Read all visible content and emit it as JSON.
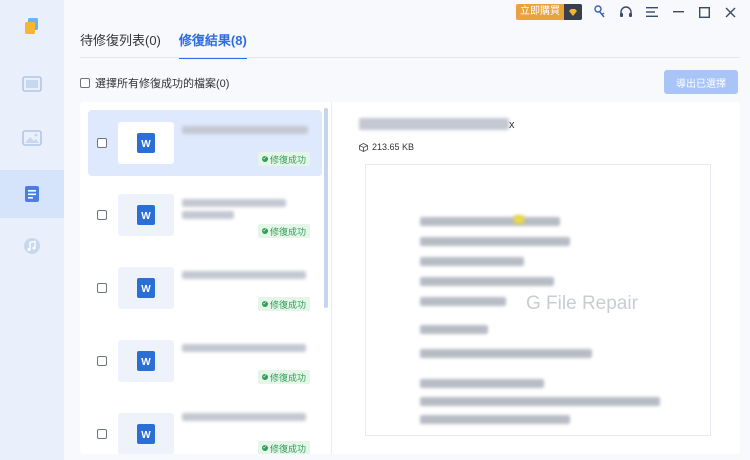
{
  "titlebar": {
    "buy_label": "立即購買"
  },
  "tabs": [
    {
      "label": "待修復列表(0)"
    },
    {
      "label": "修復結果(8)"
    }
  ],
  "select_all_label": "選擇所有修復成功的檔案(0)",
  "export_label": "導出已選擇",
  "file_list": {
    "status_label": "修復成功",
    "items_visible": 5
  },
  "preview": {
    "file_ext": "x",
    "file_size": "213.65 KB",
    "watermark": "G File Repair"
  },
  "colors": {
    "accent": "#2f6ae8",
    "success": "#2f9d57",
    "buy": "#e8a33c",
    "word_icon": "#2b6fd6"
  },
  "icons": {
    "rail": [
      "app-logo-icon",
      "video-icon",
      "image-icon",
      "document-icon",
      "music-icon"
    ],
    "titlebar": [
      "diamond-icon",
      "key-icon",
      "headset-icon",
      "menu-icon",
      "minimize-icon",
      "maximize-icon",
      "close-icon"
    ],
    "file_thumb": "word-document-icon"
  }
}
